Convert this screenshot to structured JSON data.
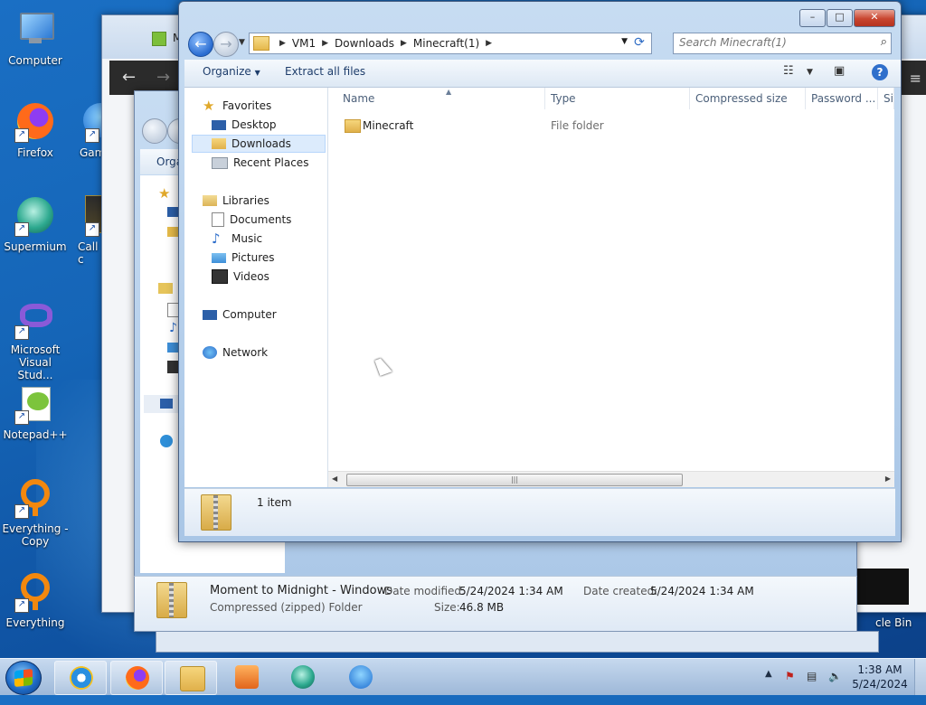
{
  "desktop": {
    "icons": [
      {
        "label": "Computer",
        "icon": "computer-icon",
        "shortcut": false
      },
      {
        "label": "Firefox",
        "icon": "firefox-icon",
        "shortcut": true
      },
      {
        "label": "Gam",
        "icon": "game-icon",
        "shortcut": true
      },
      {
        "label": "Supermium",
        "icon": "supermium-icon",
        "shortcut": true
      },
      {
        "label": "Call c",
        "icon": "call-of-duty-icon",
        "shortcut": true
      },
      {
        "label": "Microsoft Visual Stud...",
        "icon": "visual-studio-icon",
        "shortcut": true
      },
      {
        "label": "Notepad++",
        "icon": "notepad-plus-plus-icon",
        "shortcut": true
      },
      {
        "label": "Everything - Copy",
        "icon": "everything-icon",
        "shortcut": true
      },
      {
        "label": "Everything",
        "icon": "everything-icon",
        "shortcut": true
      },
      {
        "label": "cle Bin",
        "icon": "recycle-bin-icon",
        "shortcut": false
      }
    ]
  },
  "explorer": {
    "address": {
      "crumbs": [
        "VM1",
        "Downloads",
        "Minecraft(1)"
      ]
    },
    "search": {
      "placeholder": "Search Minecraft(1)"
    },
    "toolbar": {
      "organize": "Organize",
      "extract_all": "Extract all files"
    },
    "nav": {
      "favorites": "Favorites",
      "desktop": "Desktop",
      "downloads": "Downloads",
      "recent_places": "Recent Places",
      "libraries": "Libraries",
      "documents": "Documents",
      "music": "Music",
      "pictures": "Pictures",
      "videos": "Videos",
      "computer": "Computer",
      "network": "Network"
    },
    "columns": [
      "Name",
      "Type",
      "Compressed size",
      "Password ...",
      "Si"
    ],
    "rows": [
      {
        "name": "Minecraft",
        "type": "File folder"
      }
    ],
    "status": {
      "count": "1 item"
    },
    "caption": {
      "min": "–",
      "max": "□",
      "close": "✕"
    }
  },
  "background_window": {
    "organize_partial": "Orga",
    "file_name": "Moment to Midnight - Windows",
    "file_type": "Compressed (zipped) Folder",
    "date_modified_label": "Date modified:",
    "date_modified": "5/24/2024 1:34 AM",
    "date_created_label": "Date created:",
    "date_created": "5/24/2024 1:34 AM",
    "size_label": "Size:",
    "size": "46.8 MB",
    "top_title_partial": "M"
  },
  "taskbar": {
    "time": "1:38 AM",
    "date": "5/24/2024"
  },
  "colors": {
    "accent": "#2a6cd0",
    "close": "#c8452f"
  }
}
